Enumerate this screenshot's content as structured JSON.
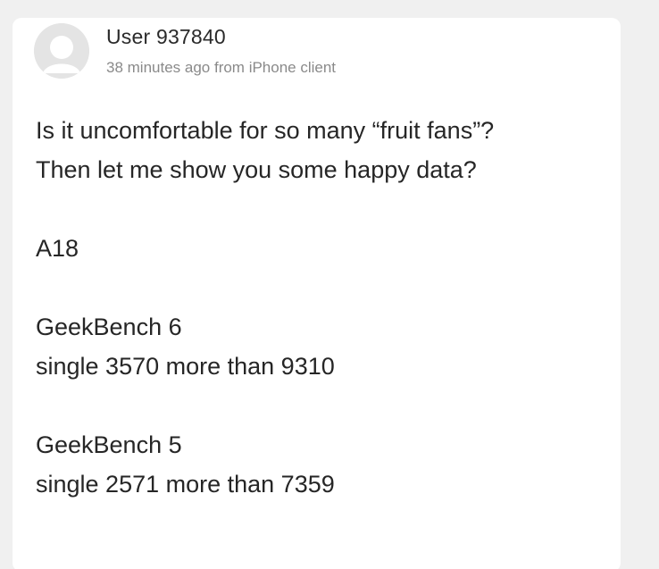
{
  "post": {
    "author": "User 937840",
    "meta": "38 minutes ago from iPhone client",
    "avatar_icon": "default-avatar-icon",
    "body_lines": [
      "Is it uncomfortable for so many “fruit fans”?",
      "Then let me show you some happy data?",
      "",
      "A18",
      "",
      "GeekBench 6",
      "single 3570 more than 9310",
      "",
      "GeekBench 5",
      "single 2571 more than 7359"
    ]
  }
}
